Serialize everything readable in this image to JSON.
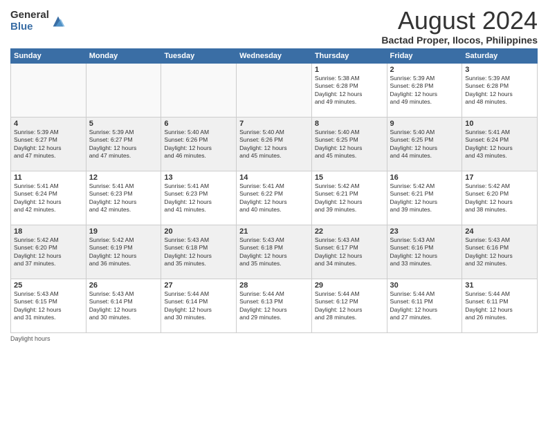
{
  "logo": {
    "general": "General",
    "blue": "Blue"
  },
  "title": "August 2024",
  "location": "Bactad Proper, Ilocos, Philippines",
  "days_of_week": [
    "Sunday",
    "Monday",
    "Tuesday",
    "Wednesday",
    "Thursday",
    "Friday",
    "Saturday"
  ],
  "footer_label": "Daylight hours",
  "weeks": [
    [
      {
        "day": "",
        "info": ""
      },
      {
        "day": "",
        "info": ""
      },
      {
        "day": "",
        "info": ""
      },
      {
        "day": "",
        "info": ""
      },
      {
        "day": "1",
        "info": "Sunrise: 5:38 AM\nSunset: 6:28 PM\nDaylight: 12 hours\nand 49 minutes."
      },
      {
        "day": "2",
        "info": "Sunrise: 5:39 AM\nSunset: 6:28 PM\nDaylight: 12 hours\nand 49 minutes."
      },
      {
        "day": "3",
        "info": "Sunrise: 5:39 AM\nSunset: 6:28 PM\nDaylight: 12 hours\nand 48 minutes."
      }
    ],
    [
      {
        "day": "4",
        "info": "Sunrise: 5:39 AM\nSunset: 6:27 PM\nDaylight: 12 hours\nand 47 minutes."
      },
      {
        "day": "5",
        "info": "Sunrise: 5:39 AM\nSunset: 6:27 PM\nDaylight: 12 hours\nand 47 minutes."
      },
      {
        "day": "6",
        "info": "Sunrise: 5:40 AM\nSunset: 6:26 PM\nDaylight: 12 hours\nand 46 minutes."
      },
      {
        "day": "7",
        "info": "Sunrise: 5:40 AM\nSunset: 6:26 PM\nDaylight: 12 hours\nand 45 minutes."
      },
      {
        "day": "8",
        "info": "Sunrise: 5:40 AM\nSunset: 6:25 PM\nDaylight: 12 hours\nand 45 minutes."
      },
      {
        "day": "9",
        "info": "Sunrise: 5:40 AM\nSunset: 6:25 PM\nDaylight: 12 hours\nand 44 minutes."
      },
      {
        "day": "10",
        "info": "Sunrise: 5:41 AM\nSunset: 6:24 PM\nDaylight: 12 hours\nand 43 minutes."
      }
    ],
    [
      {
        "day": "11",
        "info": "Sunrise: 5:41 AM\nSunset: 6:24 PM\nDaylight: 12 hours\nand 42 minutes."
      },
      {
        "day": "12",
        "info": "Sunrise: 5:41 AM\nSunset: 6:23 PM\nDaylight: 12 hours\nand 42 minutes."
      },
      {
        "day": "13",
        "info": "Sunrise: 5:41 AM\nSunset: 6:23 PM\nDaylight: 12 hours\nand 41 minutes."
      },
      {
        "day": "14",
        "info": "Sunrise: 5:41 AM\nSunset: 6:22 PM\nDaylight: 12 hours\nand 40 minutes."
      },
      {
        "day": "15",
        "info": "Sunrise: 5:42 AM\nSunset: 6:21 PM\nDaylight: 12 hours\nand 39 minutes."
      },
      {
        "day": "16",
        "info": "Sunrise: 5:42 AM\nSunset: 6:21 PM\nDaylight: 12 hours\nand 39 minutes."
      },
      {
        "day": "17",
        "info": "Sunrise: 5:42 AM\nSunset: 6:20 PM\nDaylight: 12 hours\nand 38 minutes."
      }
    ],
    [
      {
        "day": "18",
        "info": "Sunrise: 5:42 AM\nSunset: 6:20 PM\nDaylight: 12 hours\nand 37 minutes."
      },
      {
        "day": "19",
        "info": "Sunrise: 5:42 AM\nSunset: 6:19 PM\nDaylight: 12 hours\nand 36 minutes."
      },
      {
        "day": "20",
        "info": "Sunrise: 5:43 AM\nSunset: 6:18 PM\nDaylight: 12 hours\nand 35 minutes."
      },
      {
        "day": "21",
        "info": "Sunrise: 5:43 AM\nSunset: 6:18 PM\nDaylight: 12 hours\nand 35 minutes."
      },
      {
        "day": "22",
        "info": "Sunrise: 5:43 AM\nSunset: 6:17 PM\nDaylight: 12 hours\nand 34 minutes."
      },
      {
        "day": "23",
        "info": "Sunrise: 5:43 AM\nSunset: 6:16 PM\nDaylight: 12 hours\nand 33 minutes."
      },
      {
        "day": "24",
        "info": "Sunrise: 5:43 AM\nSunset: 6:16 PM\nDaylight: 12 hours\nand 32 minutes."
      }
    ],
    [
      {
        "day": "25",
        "info": "Sunrise: 5:43 AM\nSunset: 6:15 PM\nDaylight: 12 hours\nand 31 minutes."
      },
      {
        "day": "26",
        "info": "Sunrise: 5:43 AM\nSunset: 6:14 PM\nDaylight: 12 hours\nand 30 minutes."
      },
      {
        "day": "27",
        "info": "Sunrise: 5:44 AM\nSunset: 6:14 PM\nDaylight: 12 hours\nand 30 minutes."
      },
      {
        "day": "28",
        "info": "Sunrise: 5:44 AM\nSunset: 6:13 PM\nDaylight: 12 hours\nand 29 minutes."
      },
      {
        "day": "29",
        "info": "Sunrise: 5:44 AM\nSunset: 6:12 PM\nDaylight: 12 hours\nand 28 minutes."
      },
      {
        "day": "30",
        "info": "Sunrise: 5:44 AM\nSunset: 6:11 PM\nDaylight: 12 hours\nand 27 minutes."
      },
      {
        "day": "31",
        "info": "Sunrise: 5:44 AM\nSunset: 6:11 PM\nDaylight: 12 hours\nand 26 minutes."
      }
    ]
  ]
}
